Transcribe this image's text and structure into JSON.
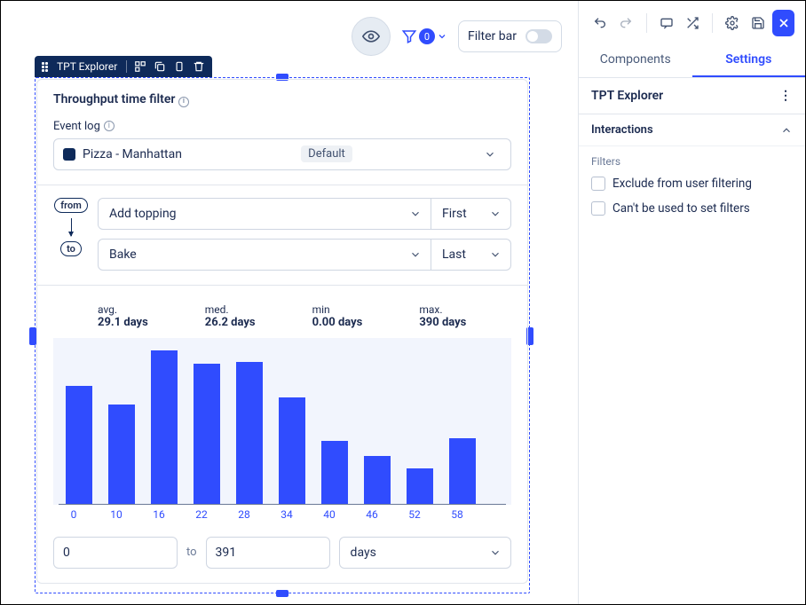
{
  "topbar": {
    "funnel_count": "0",
    "filter_bar_label": "Filter bar"
  },
  "selection": {
    "title": "TPT Explorer"
  },
  "component": {
    "title": "Throughput time filter",
    "event_log_label": "Event log",
    "event_log_value": "Pizza - Manhattan",
    "event_log_badge": "Default",
    "from_label": "from",
    "to_label": "to",
    "activity_from": "Add topping",
    "activity_from_mode": "First",
    "activity_to": "Bake",
    "activity_to_mode": "Last",
    "range_from": "0",
    "range_to_label": "to",
    "range_to": "391",
    "unit": "days"
  },
  "stats": {
    "avg_label": "avg.",
    "avg_value": "29.1 days",
    "med_label": "med.",
    "med_value": "26.2 days",
    "min_label": "min",
    "min_value": "0.00 days",
    "max_label": "max.",
    "max_value": "390 days"
  },
  "chart_data": {
    "type": "bar",
    "categories": [
      "0",
      "10",
      "16",
      "22",
      "28",
      "34",
      "40",
      "46",
      "52",
      "58"
    ],
    "values": [
      140,
      118,
      182,
      166,
      168,
      126,
      74,
      56,
      42,
      78
    ],
    "xlabel": "",
    "ylabel": "",
    "ylim": [
      0,
      190
    ],
    "title": ""
  },
  "rpanel": {
    "tab_components": "Components",
    "tab_settings": "Settings",
    "heading": "TPT Explorer",
    "accordion": "Interactions",
    "filters_label": "Filters",
    "opt_exclude": "Exclude from user filtering",
    "opt_cant_set": "Can't be used to set filters"
  }
}
